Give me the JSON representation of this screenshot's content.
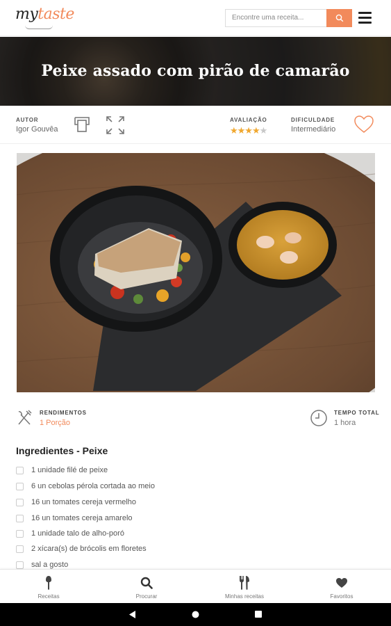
{
  "header": {
    "logo_main": "my",
    "logo_accent": "taste",
    "search_placeholder": "Encontre uma receita..."
  },
  "hero": {
    "title": "Peixe assado com pirão de camarão"
  },
  "info": {
    "author_label": "AUTOR",
    "author_name": "Igor Gouvêa",
    "rating_label": "AVALIAÇÃO",
    "rating_value": 4,
    "rating_max": 5,
    "difficulty_label": "DIFICULDADE",
    "difficulty_value": "Intermediário"
  },
  "stats": {
    "yield_label": "RENDIMENTOS",
    "yield_value": "1 Porção",
    "time_label": "TEMPO TOTAL",
    "time_value": "1 hora"
  },
  "ingredients": {
    "title": "Ingredientes - Peixe",
    "items": [
      "1 unidade filé de peixe",
      "6 un cebolas pérola cortada ao meio",
      "16 un tomates cereja vermelho",
      "16 un tomates cereja amarelo",
      "1 unidade talo de alho-poró",
      "2 xícara(s) de brócolis em floretes",
      "sal a gosto"
    ]
  },
  "nav": {
    "items": [
      {
        "label": "Receitas",
        "icon": "chef-knife-icon"
      },
      {
        "label": "Procurar",
        "icon": "search-icon"
      },
      {
        "label": "Minhas receitas",
        "icon": "utensils-icon"
      },
      {
        "label": "Favoritos",
        "icon": "heart-icon"
      }
    ]
  },
  "colors": {
    "accent": "#f28a5b",
    "star": "#f0a830"
  }
}
